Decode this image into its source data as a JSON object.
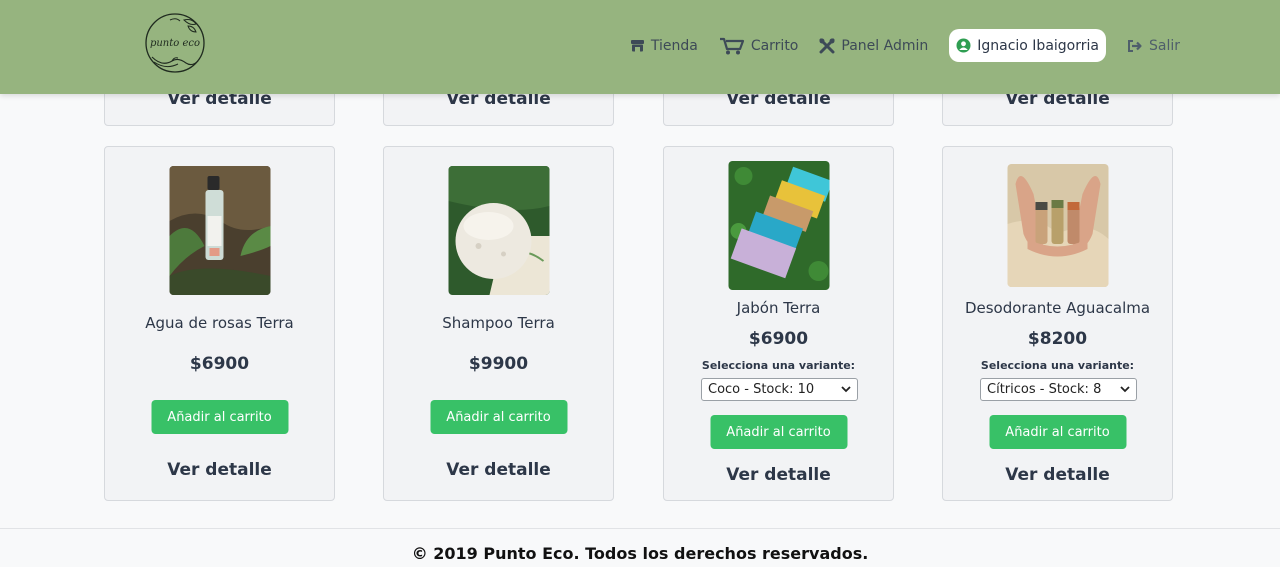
{
  "header": {
    "logo_text": "punto eco",
    "nav": {
      "shop": "Tienda",
      "cart": "Carrito",
      "admin": "Panel Admin",
      "user": "Ignacio Ibaigorria",
      "logout": "Salir"
    }
  },
  "top_row": [
    {
      "detail": "Ver detalle"
    },
    {
      "detail": "Ver detalle"
    },
    {
      "detail": "Ver detalle"
    },
    {
      "detail": "Ver detalle"
    }
  ],
  "products": [
    {
      "name": "Agua de rosas Terra",
      "price": "$6900",
      "add_label": "Añadir al carrito",
      "detail": "Ver detalle"
    },
    {
      "name": "Shampoo Terra",
      "price": "$9900",
      "add_label": "Añadir al carrito",
      "detail": "Ver detalle"
    },
    {
      "name": "Jabón Terra",
      "price": "$6900",
      "variant_label": "Selecciona una variante:",
      "variant_selected": "Coco - Stock: 10",
      "add_label": "Añadir al carrito",
      "detail": "Ver detalle"
    },
    {
      "name": "Desodorante Aguacalma",
      "price": "$8200",
      "variant_label": "Selecciona una variante:",
      "variant_selected": "Cítricos - Stock: 8",
      "add_label": "Añadir al carrito",
      "detail": "Ver detalle"
    }
  ],
  "footer": {
    "text": "© 2019 Punto Eco. Todos los derechos reservados."
  },
  "colors": {
    "header_bg": "#96b47f",
    "button": "#38c167",
    "card_bg": "#f2f3f5"
  }
}
